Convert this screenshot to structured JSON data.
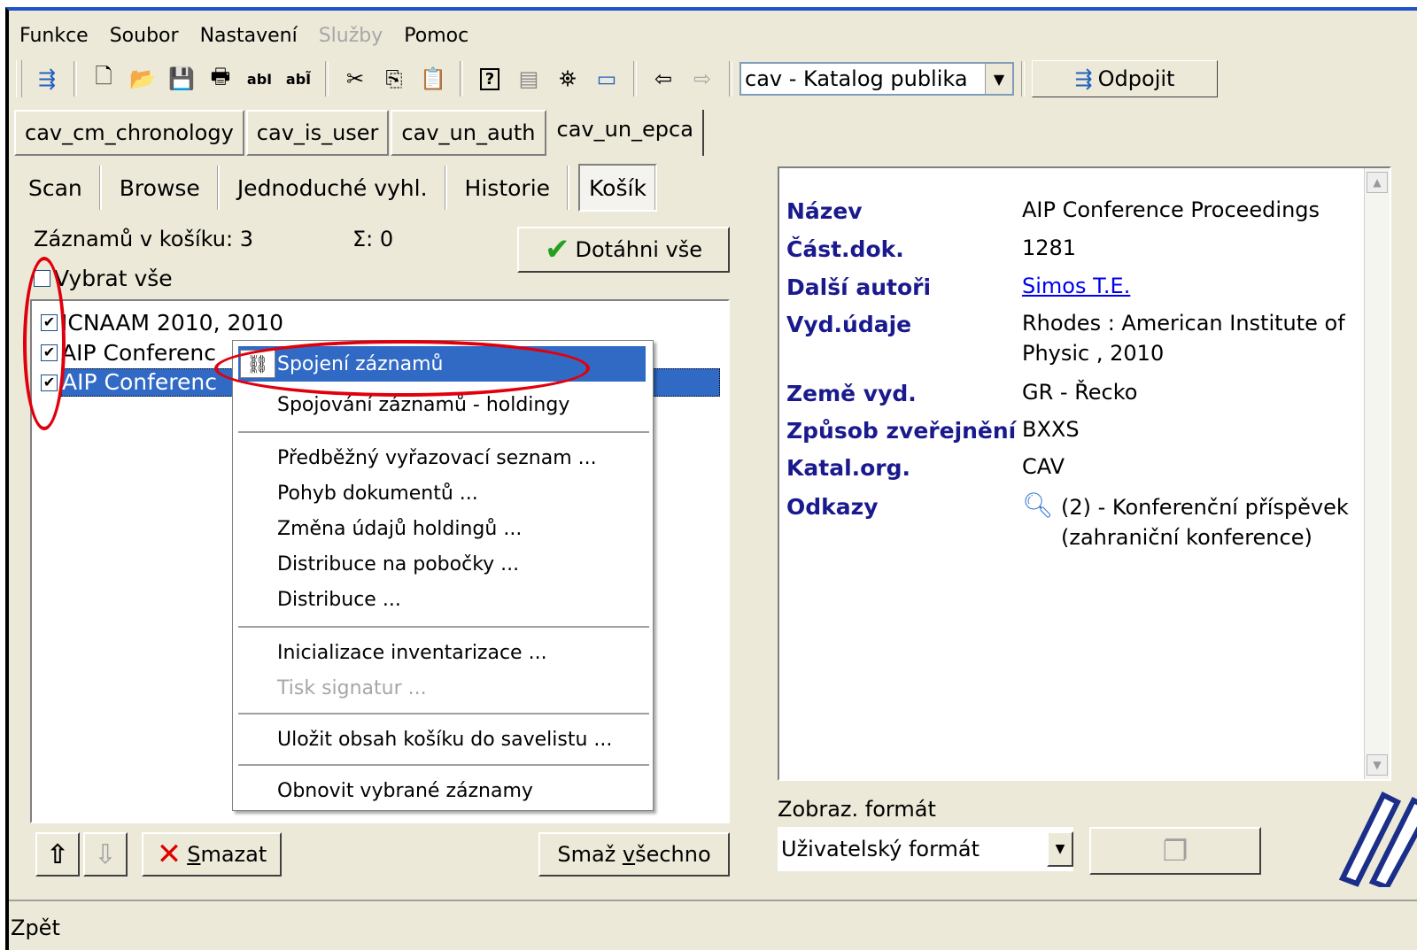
{
  "menu": [
    "Funkce",
    "Soubor",
    "Nastavení",
    "Služby",
    "Pomoc"
  ],
  "menu_disabled_index": 3,
  "toolbar": {
    "icons": [
      "connect-icon",
      "new-doc-icon",
      "open-folder-icon",
      "save-icon",
      "print-icon",
      "ab-edit-icon",
      "ab-edit2-icon",
      "cut-icon",
      "copy-icon",
      "paste-icon",
      "help-icon",
      "document-icon",
      "binoculars-icon",
      "window-icon",
      "back-arrow-icon",
      "forward-arrow-icon"
    ],
    "database_value": "cav - Katalog publika",
    "disconnect_label": "Odpojit"
  },
  "db_tabs": [
    "cav_cm_chronology",
    "cav_is_user",
    "cav_un_auth",
    "cav_un_epca"
  ],
  "search_tabs": [
    "Scan",
    "Browse",
    "Jednoduché vyhl.",
    "Historie",
    "Košík"
  ],
  "basket": {
    "count_label": "Záznamů v košíku: 3",
    "sigma_label": "Σ: 0",
    "fetch_all_label": "Dotáhni vše",
    "select_all_label": "Vybrat vše",
    "items": [
      {
        "label": "ICNAAM 2010, 2010",
        "checked": true
      },
      {
        "label": "AIP Conferenc",
        "checked": true
      },
      {
        "label": "AIP Conferenc",
        "checked": true
      }
    ],
    "delete_prefix": "S",
    "delete_rest": "mazat",
    "delete_all_prefix": "Smaž ",
    "delete_all_accel": "v",
    "delete_all_rest": "šechno"
  },
  "context_menu": {
    "items": [
      {
        "label": "Spojení záznamů",
        "highlighted": true
      },
      {
        "label": "Spojování záznamů - holdingy"
      },
      {
        "label": "Předběžný vyřazovací seznam ..."
      },
      {
        "label": "Pohyb dokumentů ..."
      },
      {
        "label": "Změna údajů holdingů ..."
      },
      {
        "label": "Distribuce na pobočky ..."
      },
      {
        "label": "Distribuce ..."
      },
      {
        "label": "Inicializace inventarizace ..."
      },
      {
        "label": "Tisk signatur ...",
        "disabled": true
      },
      {
        "label": "Uložit obsah košíku do savelistu ..."
      },
      {
        "label": "Obnovit vybrané záznamy"
      }
    ]
  },
  "record": {
    "fields": [
      {
        "label": "Název",
        "value": "AIP Conference Proceedings"
      },
      {
        "label": "Část.dok.",
        "value": "1281"
      },
      {
        "label": "Další autoři",
        "value": "Simos T.E."
      },
      {
        "label": "Vyd.údaje",
        "value": "Rhodes : American Institute of Physic , 2010"
      },
      {
        "label": "Země vyd.",
        "value": "GR - Řecko"
      },
      {
        "label": "Způsob zveřejnění",
        "value": "BXXS"
      },
      {
        "label": "Katal.org.",
        "value": "CAV"
      },
      {
        "label": "Odkazy",
        "value": "(2) - Konferenční příspěvek (zahraniční konference)"
      }
    ]
  },
  "format": {
    "label": "Zobraz. formát",
    "value": "Uživatelský formát"
  },
  "status_text": "Zpět",
  "colors": {
    "selection": "#316ac5",
    "annotation": "#e0000d",
    "label_blue": "#1a1a8e"
  }
}
